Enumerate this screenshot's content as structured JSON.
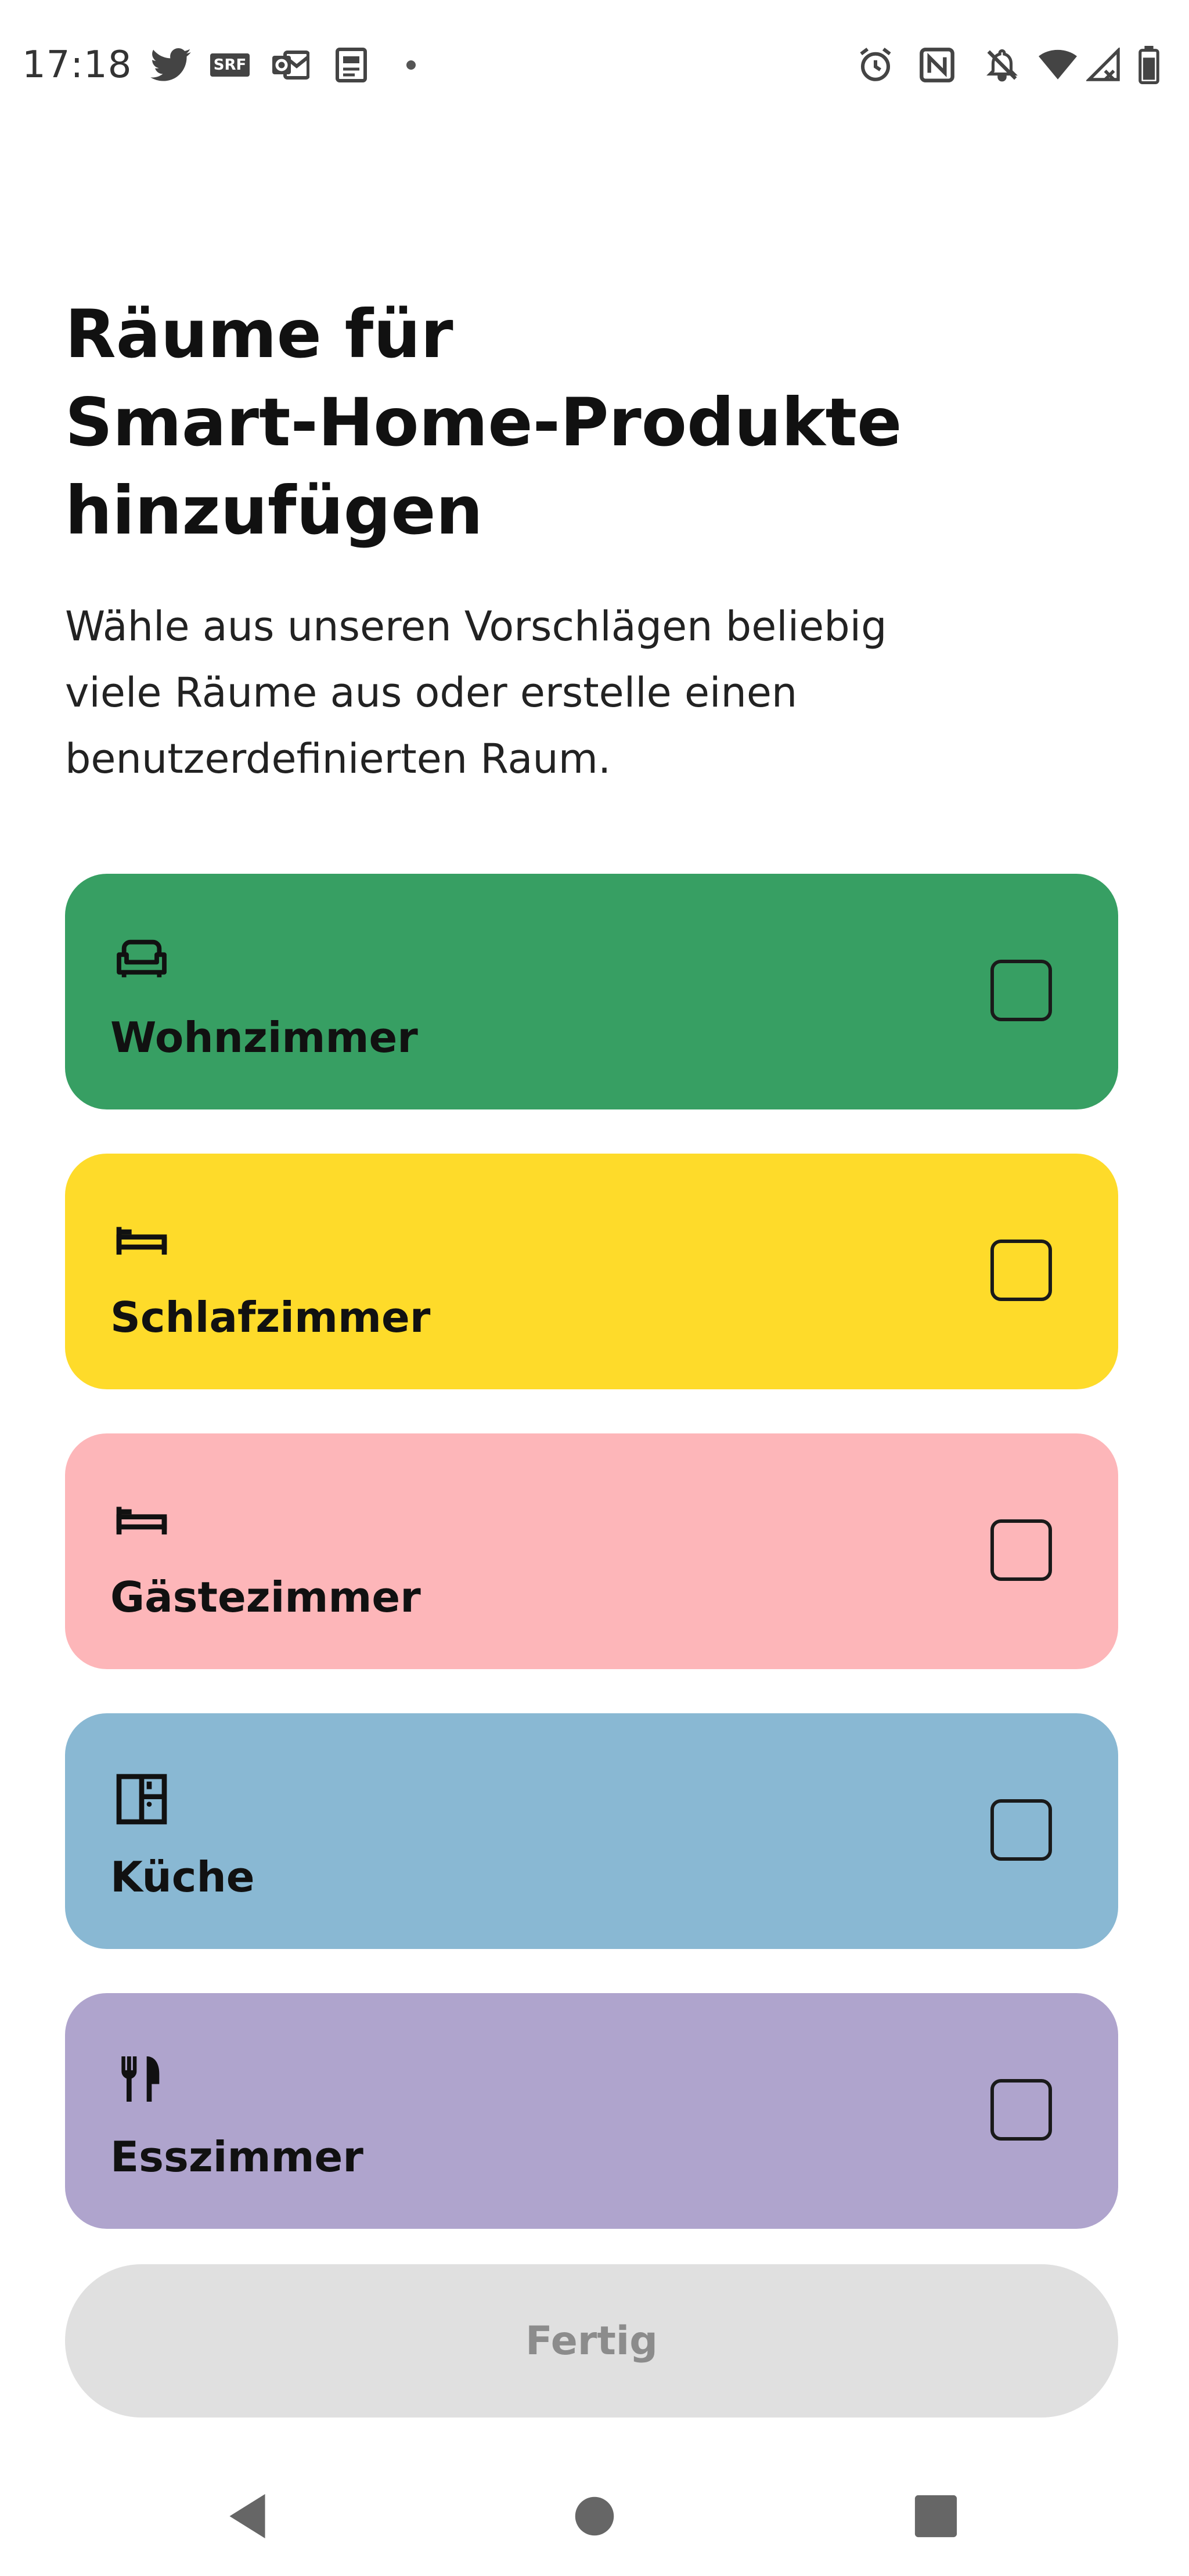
{
  "status_bar": {
    "time": "17:18",
    "left_icons": [
      "twitter-icon",
      "srf-icon",
      "outlook-icon",
      "news-app-icon",
      "notification-dot-icon"
    ],
    "srf_text": "SRF",
    "right_icons": [
      "alarm-icon",
      "nfc-icon",
      "bell-off-icon",
      "wifi-icon",
      "cell-signal-icon",
      "battery-icon"
    ]
  },
  "header": {
    "title_lines": [
      "Räume für",
      "Smart-Home-Produkte",
      "hinzufügen"
    ],
    "description_lines": [
      "Wähle aus unseren Vorschlägen beliebig",
      "viele Räume aus oder erstelle einen",
      "benutzerdefinierten Raum."
    ]
  },
  "rooms": [
    {
      "label": "Wohnzimmer",
      "icon": "sofa-icon",
      "color": "#379f63",
      "checked": false
    },
    {
      "label": "Schlafzimmer",
      "icon": "bed-icon",
      "color": "#fedb2a",
      "checked": false
    },
    {
      "label": "Gästezimmer",
      "icon": "bed-icon",
      "color": "#fdb6b9",
      "checked": false
    },
    {
      "label": "Küche",
      "icon": "fridge-icon",
      "color": "#89b8d3",
      "checked": false
    },
    {
      "label": "Esszimmer",
      "icon": "cutlery-icon",
      "color": "#afa4cd",
      "checked": false
    }
  ],
  "done_button": {
    "label": "Fertig",
    "enabled": false
  },
  "nav_bar": {
    "icons": [
      "back-icon",
      "home-icon",
      "recents-icon"
    ]
  },
  "colors": {
    "background": "#ffffff",
    "done_button_bg": "#e0e0e0",
    "done_button_text": "#8c8c8c"
  }
}
